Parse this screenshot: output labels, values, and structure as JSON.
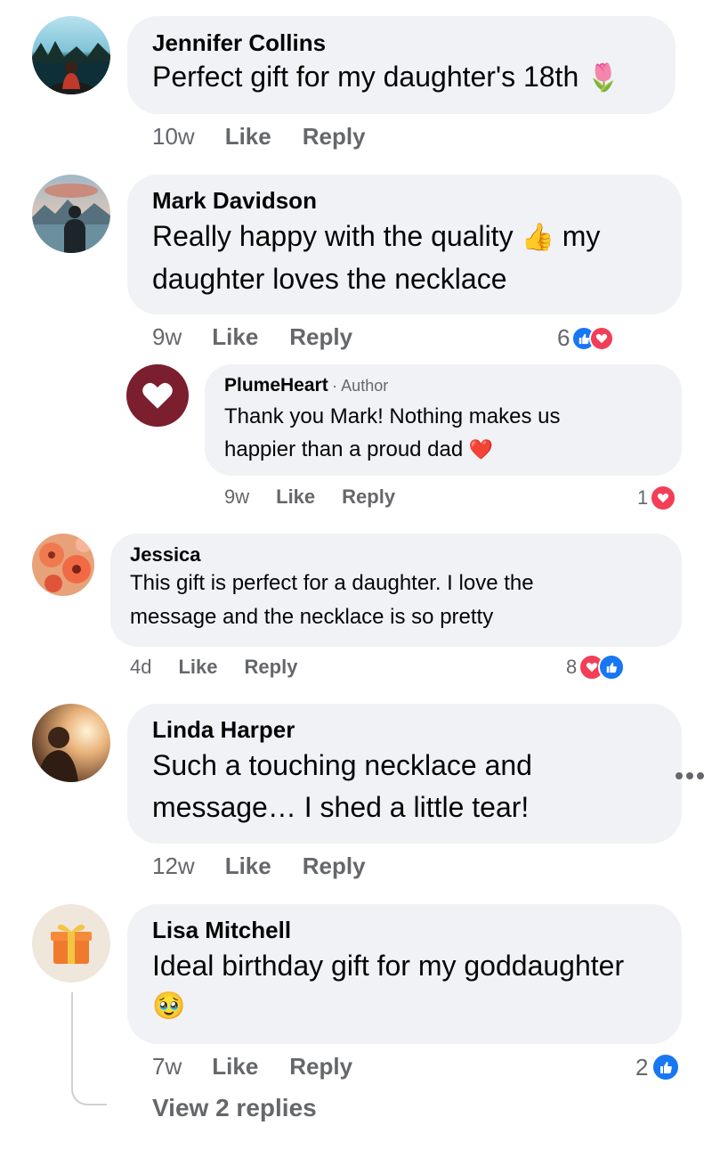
{
  "colors": {
    "bubble": "#f0f2f5",
    "meta": "#65676b",
    "like_blue": "#1877f2",
    "love_red": "#f33e58",
    "brand": "#7b1f2e"
  },
  "comments": [
    {
      "author": "Jennifer Collins",
      "text": "Perfect gift for my daughter's 18th",
      "emoji": "🌷",
      "time": "10w",
      "like_label": "Like",
      "reply_label": "Reply"
    },
    {
      "author": "Mark Davidson",
      "text_a": "Really happy with the quality",
      "emoji": "👍",
      "text_b": "my",
      "text_c": "daughter loves the necklace",
      "time": "9w",
      "like_label": "Like",
      "reply_label": "Reply",
      "reaction_count": "6",
      "reply": {
        "author": "PlumeHeart",
        "badge": "· Author",
        "text_a": "Thank you Mark! Nothing makes us",
        "text_b": "happier than a proud dad",
        "emoji": "❤️",
        "time": "9w",
        "like_label": "Like",
        "reply_label": "Reply",
        "reaction_count": "1"
      }
    },
    {
      "author": "Jessica",
      "text_a": "This gift is perfect for a daughter. I love the",
      "text_b": "message and the necklace is so pretty",
      "time": "4d",
      "like_label": "Like",
      "reply_label": "Reply",
      "reaction_count": "8"
    },
    {
      "author": "Linda Harper",
      "text_a": "Such a touching necklace and",
      "text_b": "message… I shed a little tear!",
      "time": "12w",
      "like_label": "Like",
      "reply_label": "Reply"
    },
    {
      "author": "Lisa Mitchell",
      "text_a": "Ideal birthday gift for my goddaughter",
      "emoji": "🥹",
      "time": "7w",
      "like_label": "Like",
      "reply_label": "Reply",
      "reaction_count": "2",
      "view_replies": "View 2 replies"
    }
  ],
  "icons": {
    "more": "more-options-icon",
    "like": "thumbs-up-icon",
    "love": "heart-icon",
    "gift": "gift-icon"
  }
}
